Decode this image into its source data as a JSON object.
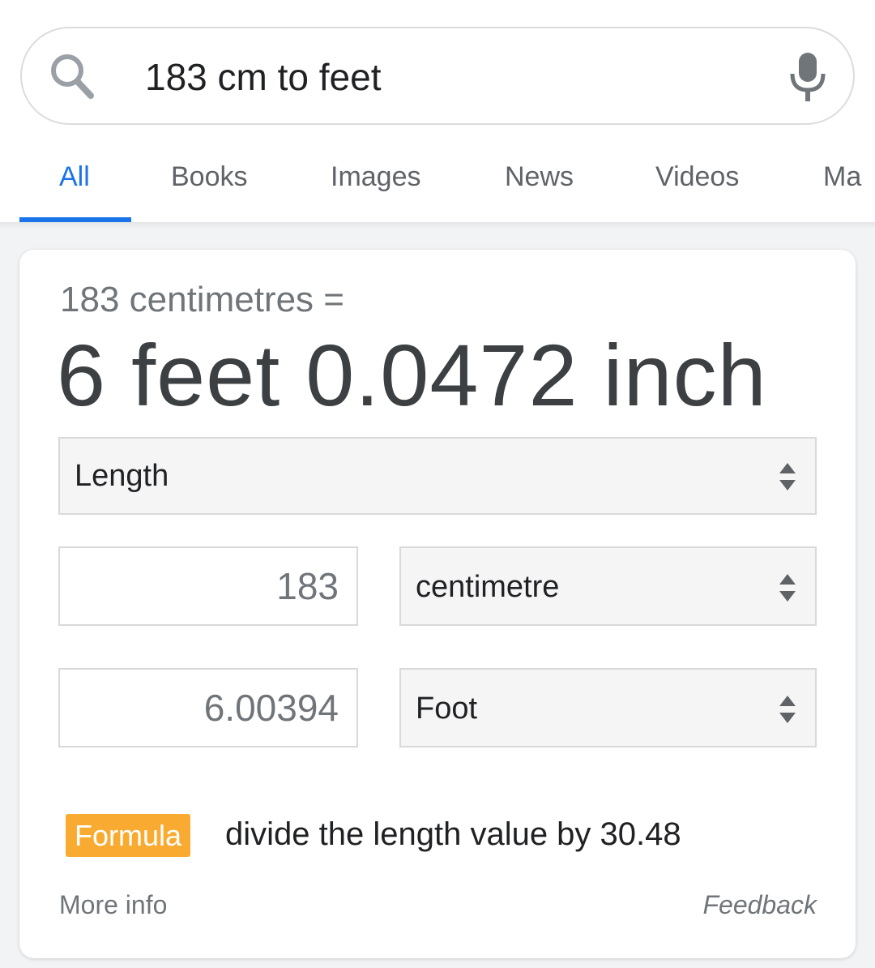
{
  "search": {
    "query": "183 cm to feet"
  },
  "tabs": [
    {
      "label": "All",
      "active": true
    },
    {
      "label": "Books",
      "active": false
    },
    {
      "label": "Images",
      "active": false
    },
    {
      "label": "News",
      "active": false
    },
    {
      "label": "Videos",
      "active": false
    },
    {
      "label": "Ma",
      "active": false
    }
  ],
  "converter": {
    "equation": "183 centimetres =",
    "result": "6 feet 0.0472 inch",
    "unit_type": "Length",
    "from_value": "183",
    "from_unit": "centimetre",
    "to_value": "6.00394",
    "to_unit": "Foot",
    "formula_label": "Formula",
    "formula_text": "divide the length value by 30.48",
    "more_info": "More info",
    "feedback": "Feedback"
  },
  "colors": {
    "accent": "#1a73e8",
    "formula_badge": "#f9ab31"
  }
}
